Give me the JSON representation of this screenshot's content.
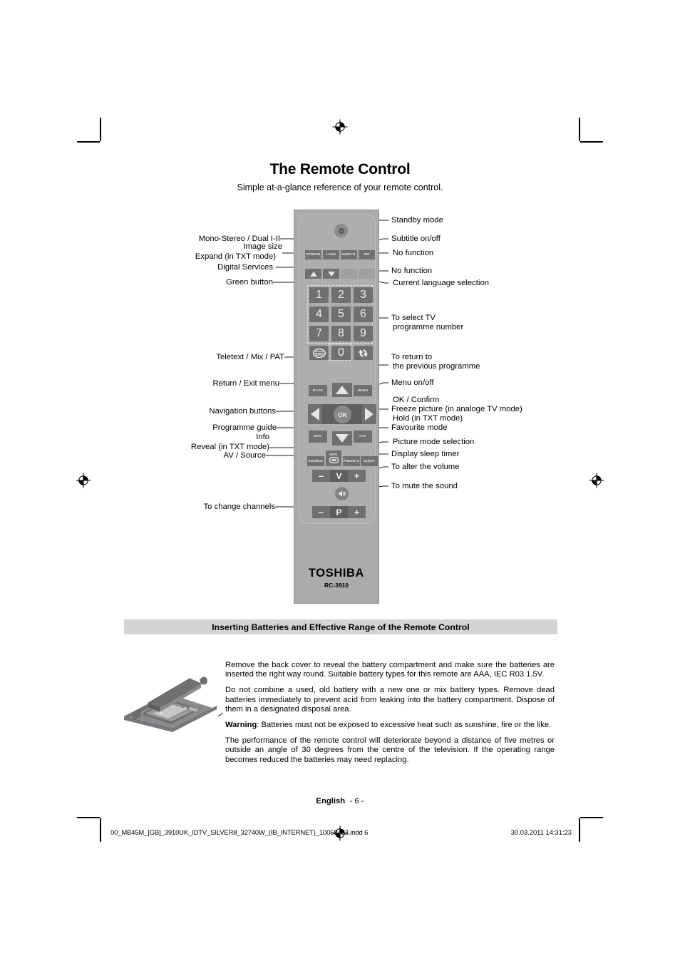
{
  "page": {
    "title": "The Remote Control",
    "subtitle": "Simple at-a-glance reference of your remote control.",
    "section_heading": "Inserting Batteries and Effective Range of the Remote Control",
    "footer_language": "English",
    "footer_page": "- 6 -",
    "footer_file": "00_MB45M_[GB]_3910UK_IDTV_SILVER8_32740W_(IB_INTERNET)_10068433.indd   6",
    "footer_timestamp": "30.03.2011   14:31:23"
  },
  "remote": {
    "brand": "TOSHIBA",
    "model": "RC-3910",
    "buttons": {
      "screen": "SCREEN",
      "lang": "LANG",
      "subtitle": "SUBTITL",
      "pip": "PIP",
      "back": "BACK",
      "menu": "MENU",
      "ok": "OK",
      "epg": "EPG",
      "fav": "FAV",
      "source": "SOURCE",
      "info": "INFO",
      "presets": "PRESETS",
      "sleep": "SLEEP",
      "volume_label": "V",
      "programme_label": "P",
      "minus": "–",
      "plus": "+",
      "zero": "0"
    },
    "numpad": [
      "1",
      "2",
      "3",
      "4",
      "5",
      "6",
      "7",
      "8",
      "9"
    ]
  },
  "labels_left": [
    {
      "id": "mono-stereo",
      "text": "Mono-Stereo / Dual I-II"
    },
    {
      "id": "image-size",
      "text": "Image size"
    },
    {
      "id": "expand-txt",
      "text": "Expand (in TXT mode)"
    },
    {
      "id": "digital-services",
      "text": "Digital Services"
    },
    {
      "id": "green-button",
      "text": "Green button"
    },
    {
      "id": "teletext",
      "text": "Teletext / Mix / PAT"
    },
    {
      "id": "return-exit",
      "text": "Return / Exit menu"
    },
    {
      "id": "navigation",
      "text": "Navigation buttons"
    },
    {
      "id": "programme-guide",
      "text": "Programme guide"
    },
    {
      "id": "info",
      "text": "Info"
    },
    {
      "id": "reveal-txt",
      "text": "Reveal (in TXT mode)"
    },
    {
      "id": "av-source",
      "text": "AV / Source"
    },
    {
      "id": "change-channels",
      "text": "To change channels"
    }
  ],
  "labels_right": [
    {
      "id": "standby",
      "text": "Standby mode"
    },
    {
      "id": "subtitle",
      "text": "Subtitle on/off"
    },
    {
      "id": "no-function-1",
      "text": "No function"
    },
    {
      "id": "no-function-2",
      "text": "No function"
    },
    {
      "id": "current-language",
      "text": "Current language selection"
    },
    {
      "id": "select-tv-1",
      "text": "To select TV"
    },
    {
      "id": "select-tv-2",
      "text": "programme number"
    },
    {
      "id": "return-prev-1",
      "text": "To return to"
    },
    {
      "id": "return-prev-2",
      "text": "the previous programme"
    },
    {
      "id": "menu-onoff",
      "text": "Menu on/off"
    },
    {
      "id": "ok-confirm",
      "text": "OK / Confirm"
    },
    {
      "id": "freeze-picture",
      "text": "Freeze picture (in analoge TV mode)"
    },
    {
      "id": "hold-txt",
      "text": "Hold (in TXT mode)"
    },
    {
      "id": "favourite-mode",
      "text": "Favourite mode"
    },
    {
      "id": "picture-mode",
      "text": "Picture mode selection"
    },
    {
      "id": "sleep-timer",
      "text": "Display sleep timer"
    },
    {
      "id": "alter-volume",
      "text": "To alter the volume"
    },
    {
      "id": "mute-sound",
      "text": "To mute the sound"
    }
  ],
  "battery_text": {
    "p1": "Remove the back cover to reveal the battery compartment and make sure the batteries are inserted the right way round. Suitable battery types for this remote are  AAA, IEC R03 1.5V.",
    "p2": "Do not combine a used, old battery with a new one or mix battery types. Remove dead batteries immediately to prevent acid from leaking into the battery compartment. Dispose of them in a designated disposal area.",
    "p3_strong": "Warning",
    "p3": ": Batteries must not be exposed to excessive heat such as sunshine, fire or the like.",
    "p4": "The performance of the remote control will deteriorate beyond a distance of five metres or outside an angle of 30 degrees from the centre of the television. If the operating range becomes reduced the batteries may need replacing."
  },
  "colors": {
    "remote_body": "#aaabab",
    "button_dark": "#6f7071",
    "section_bar": "#d3d4d4",
    "text": "#000000"
  }
}
